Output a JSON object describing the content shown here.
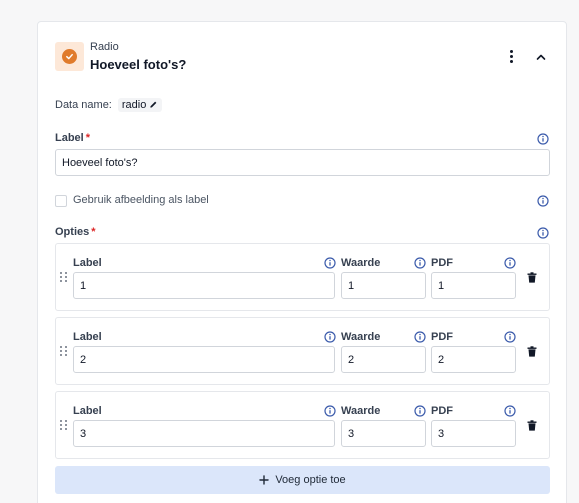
{
  "question": {
    "type_label": "Radio",
    "title": "Hoeveel foto's?"
  },
  "data_name": {
    "label": "Data name:",
    "value": "radio"
  },
  "label_field": {
    "label": "Label",
    "required_mark": "*",
    "value": "Hoeveel foto's?"
  },
  "image_label_checkbox": {
    "label": "Gebruik afbeelding als label",
    "checked": false
  },
  "options_section": {
    "label": "Opties",
    "required_mark": "*",
    "column_labels": {
      "label": "Label",
      "waarde": "Waarde",
      "pdf": "PDF"
    },
    "options": [
      {
        "label": "1",
        "waarde": "1",
        "pdf": "1"
      },
      {
        "label": "2",
        "waarde": "2",
        "pdf": "2"
      },
      {
        "label": "3",
        "waarde": "3",
        "pdf": "3"
      }
    ],
    "add_button_label": "Voeg optie toe"
  },
  "colors": {
    "accent_orange": "#e07b2c",
    "icon_bg": "#fde8d8",
    "info_blue": "#3b5bab",
    "required_red": "#dc2626",
    "add_button_bg": "#dbe6fa"
  },
  "icons": [
    "check-icon",
    "more-vertical-icon",
    "chevron-up-icon",
    "pencil-icon",
    "info-icon",
    "drag-handle-icon",
    "trash-icon",
    "plus-icon"
  ]
}
